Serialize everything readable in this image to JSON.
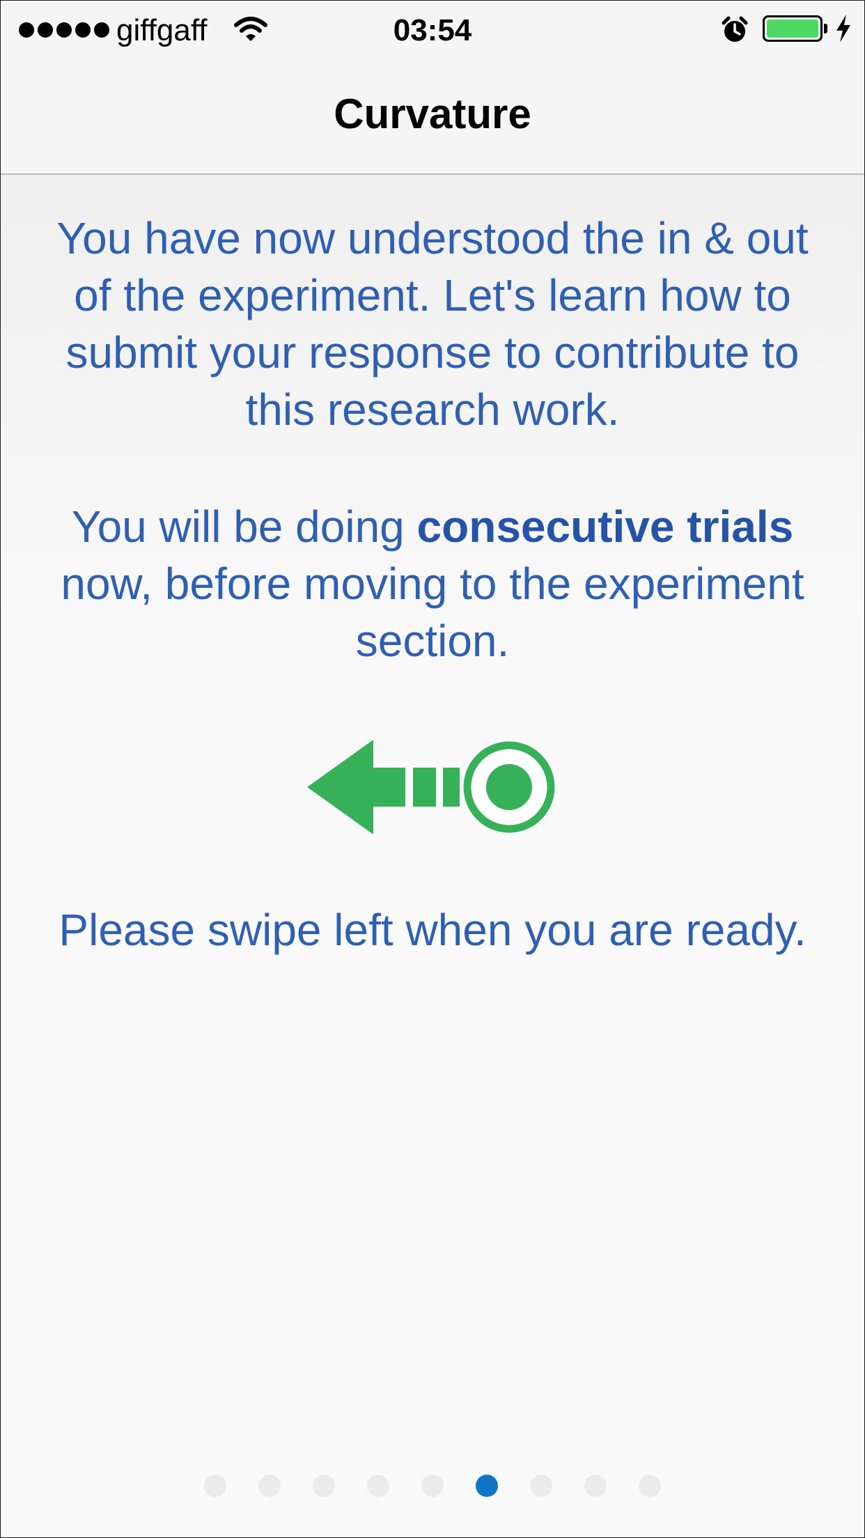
{
  "status_bar": {
    "carrier": "giffgaff",
    "time": "03:54",
    "signal_bars": 5,
    "battery_level": 1.0,
    "icons": [
      "signal-dots-icon",
      "wifi-icon",
      "alarm-icon",
      "battery-icon",
      "charging-bolt-icon"
    ]
  },
  "nav": {
    "title": "Curvature"
  },
  "content": {
    "intro": "You have now understood the in & out of the experiment. Let's learn how to submit your response to contribute to this research work.",
    "trials_prefix": "You will be doing ",
    "trials_bold": "consecutive trials",
    "trials_suffix": " now, before moving to the experiment section.",
    "swipe_icon": "swipe-left-arrow-icon",
    "swipe_instruction": "Please swipe left when you are ready."
  },
  "pager": {
    "total": 9,
    "current": 6
  },
  "colors": {
    "text_blue": "#2f5fb3",
    "icon_green": "#36b15a",
    "active_dot": "#1075c8",
    "inactive_dot": "#ebebeb",
    "battery_green": "#4cd964"
  }
}
